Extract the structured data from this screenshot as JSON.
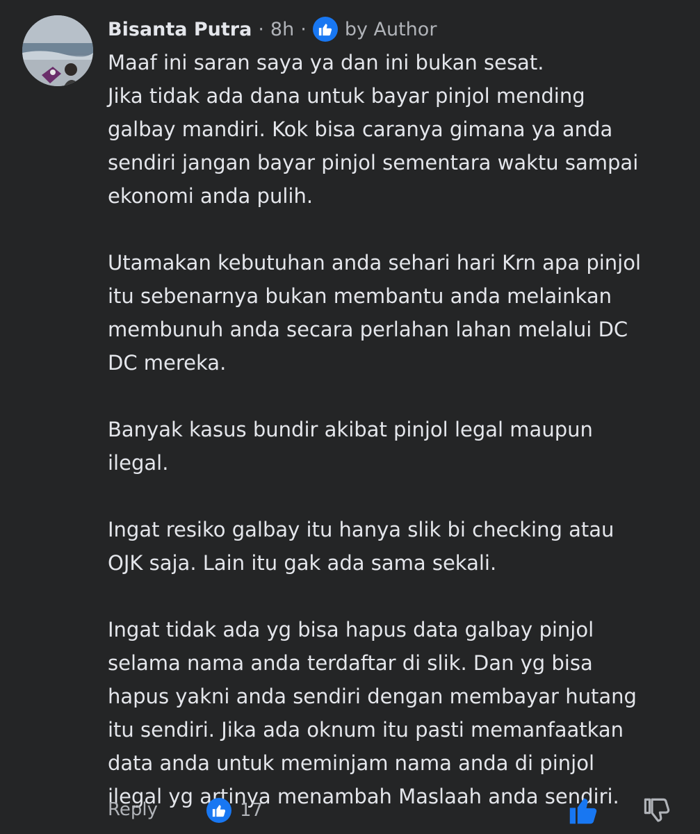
{
  "comment": {
    "author": "Bisanta Putra",
    "time": "8h",
    "separator": "·",
    "badge_label": "by Author",
    "paragraphs": [
      "Maaf ini saran saya ya dan ini bukan sesat.\nJika tidak ada dana untuk bayar pinjol mending\ngalbay mandiri. Kok bisa caranya gimana ya anda\nsendiri jangan bayar pinjol sementara waktu sampai\nekonomi anda pulih.",
      "Utamakan kebutuhan anda sehari hari Krn apa pinjol\nitu sebenarnya bukan membantu anda melainkan\nmembunuh anda secara perlahan lahan melalui DC\nDC mereka.",
      "Banyak kasus bundir akibat pinjol legal maupun\nilegal.",
      "Ingat resiko galbay itu hanya slik bi checking atau\nOJK saja. Lain itu gak ada sama sekali.",
      "Ingat tidak ada yg bisa hapus data galbay pinjol\nselama nama anda terdaftar di slik. Dan yg bisa\nhapus yakni anda sendiri dengan membayar hutang\nitu sendiri. Jika ada oknum itu pasti memanfaatkan\ndata anda untuk meminjam nama anda di pinjol\nilegal yg artinya menambah Maslaah anda sendiri."
    ]
  },
  "footer": {
    "reply_label": "Reply",
    "reaction_count": "17",
    "reaction_icon": "like-icon",
    "like_button_icon": "thumbs-up-icon",
    "dislike_button_icon": "thumbs-down-icon"
  },
  "colors": {
    "background": "#242526",
    "primary_text": "#e4e6eb",
    "secondary_text": "#b0b3b8",
    "accent": "#1877f2"
  }
}
